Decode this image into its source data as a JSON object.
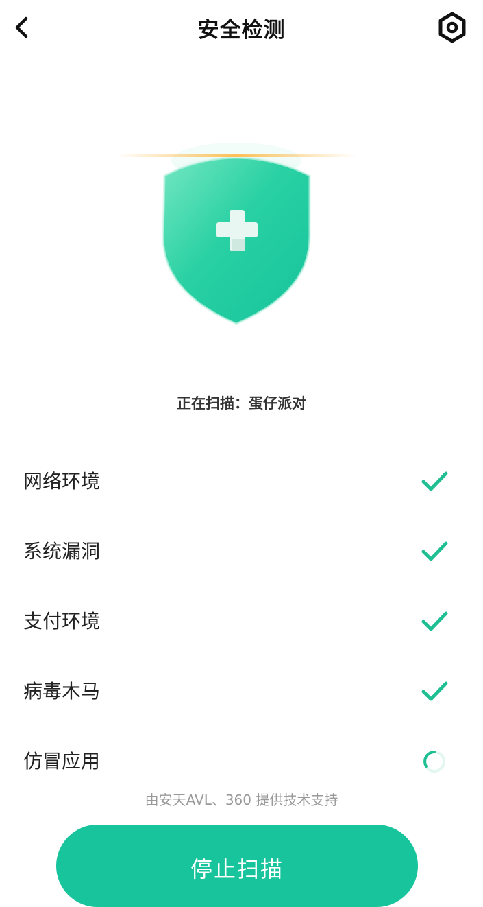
{
  "header": {
    "title": "安全检测",
    "back_icon": "chevron-left-icon",
    "settings_icon": "hexagon-settings-icon"
  },
  "shield": {
    "icon": "shield-plus-icon",
    "color": "#18c49c"
  },
  "scan": {
    "status_text": "正在扫描：蛋仔派对"
  },
  "checks": [
    {
      "label": "网络环境",
      "status": "done"
    },
    {
      "label": "系统漏洞",
      "status": "done"
    },
    {
      "label": "支付环境",
      "status": "done"
    },
    {
      "label": "病毒木马",
      "status": "done"
    },
    {
      "label": "仿冒应用",
      "status": "scanning"
    }
  ],
  "footer": {
    "support_text": "由安天AVL、360 提供技术支持",
    "stop_label": "停止扫描"
  },
  "colors": {
    "accent": "#18c49c",
    "check": "#1fbf93",
    "scan_line": "#ffb946"
  }
}
